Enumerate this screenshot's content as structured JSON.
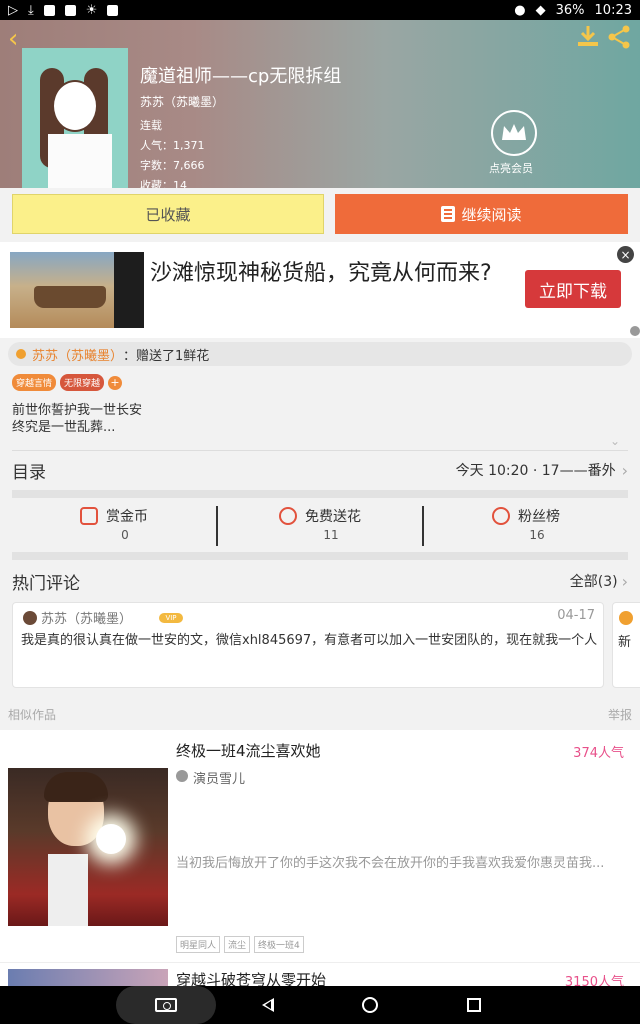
{
  "status_bar": {
    "battery": "36%",
    "time": "10:23"
  },
  "book": {
    "title": "魔道祖师——cp无限拆组",
    "author": "苏苏（苏曦墨）",
    "status": "连载",
    "popularity_label": "人气：",
    "popularity": "1,371",
    "words_label": "字数：",
    "words": "7,666",
    "favorites_label": "收藏：",
    "favorites": "14"
  },
  "vip": {
    "label": "点亮会员"
  },
  "actions": {
    "favorited": "已收藏",
    "continue": "继续阅读"
  },
  "ad": {
    "headline": "沙滩惊现神秘货船，究竟从何而来?",
    "button": "立即下载",
    "close": "×"
  },
  "gift": {
    "user": "苏苏（苏曦墨）",
    "text": "：赠送了1鲜花"
  },
  "tags": [
    "穿越言情",
    "无限穿越"
  ],
  "intro": [
    "前世你誓护我一世长安",
    "终究是一世乱葬..."
  ],
  "toc": {
    "label": "目录",
    "latest": "今天 10:20 · 17——番外"
  },
  "stats": [
    {
      "label": "赏金币",
      "value": "0",
      "icon": "coin-icon"
    },
    {
      "label": "免费送花",
      "value": "11",
      "icon": "flower-icon"
    },
    {
      "label": "粉丝榜",
      "value": "16",
      "icon": "medal-icon"
    }
  ],
  "hot_comments": {
    "label": "热门评论",
    "all": "全部(3)",
    "items": [
      {
        "user": "苏苏（苏曦墨）",
        "badge": "VIP",
        "date": "04-17",
        "text": "我是真的很认真在做一世安的文，微信xhl845697，有意者可以加入一世安团队的，现在就我一个人"
      }
    ],
    "peek_text": "新"
  },
  "similar": {
    "label": "相似作品",
    "report": "举报",
    "items": [
      {
        "title": "终极一班4流尘喜欢她",
        "popularity": "374人气",
        "author": "演员雪儿",
        "desc": "当初我后悔放开了你的手这次我不会在放开你的手我喜欢我爱你惠灵苗我...",
        "tags": [
          "明星同人",
          "流尘",
          "终极一班4"
        ]
      },
      {
        "title": "穿越斗破苍穹从零开始",
        "popularity": "3150人气"
      }
    ]
  }
}
